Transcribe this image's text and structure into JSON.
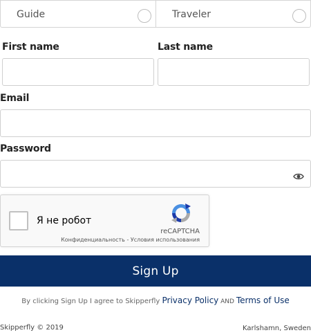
{
  "roles": {
    "guide_label": "Guide",
    "traveler_label": "Traveler"
  },
  "form": {
    "first_name_label": "First name",
    "first_name_value": "",
    "last_name_label": "Last name",
    "last_name_value": "",
    "email_label": "Email",
    "email_value": "",
    "password_label": "Password",
    "password_value": ""
  },
  "captcha": {
    "checkbox_label": "Я не робот",
    "brand": "reCAPTCHA",
    "privacy_link": "Конфиденциальность",
    "separator": " - ",
    "terms_link": "Условия использования"
  },
  "actions": {
    "signup_label": "Sign Up"
  },
  "agreement": {
    "prefix": "By clicking Sign Up I agree to Skipperfly ",
    "privacy_link": "Privacy Policy",
    "and": " AND ",
    "terms_link": "Terms of Use"
  },
  "footer": {
    "copyright": "Skipperfly © 2019",
    "location": "Karlshamn, Sweden"
  },
  "colors": {
    "primary": "#0a3069",
    "border": "#cfcfcf"
  },
  "icons": {
    "password_toggle": "eye-icon",
    "captcha_logo": "recaptcha-logo"
  }
}
